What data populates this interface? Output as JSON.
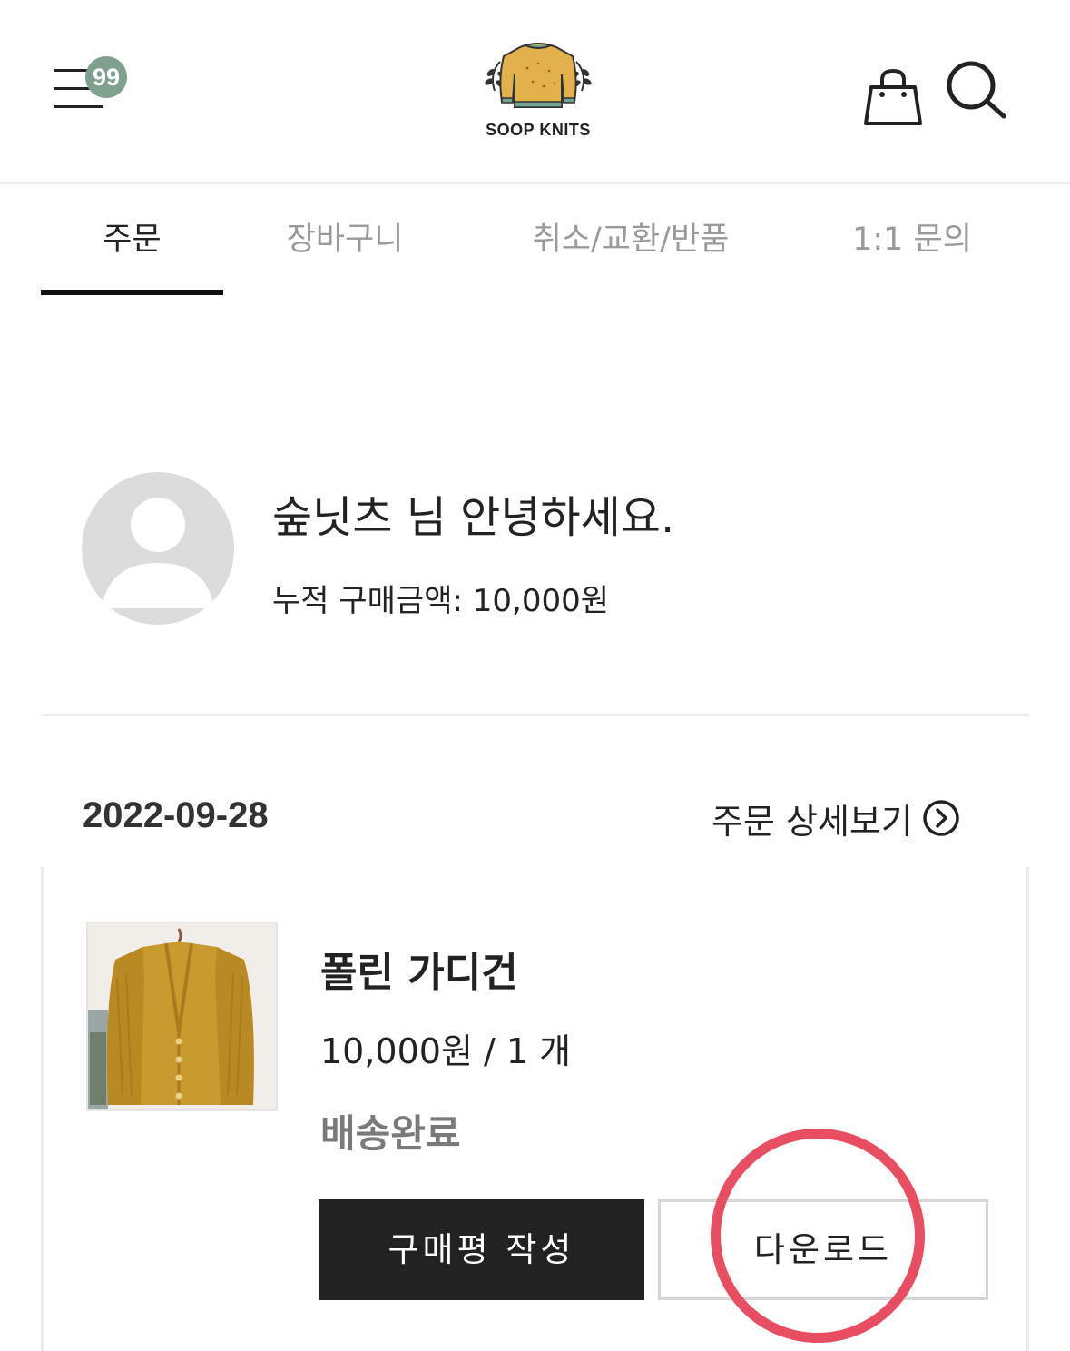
{
  "header": {
    "menu_badge": "99",
    "logo_text": "SOOP KNITS",
    "icons": {
      "menu": "hamburger-menu-icon",
      "cart": "shopping-bag-icon",
      "search": "search-icon"
    },
    "badge_color": "#7fa08e"
  },
  "tabs": [
    {
      "label": "주문",
      "active": true
    },
    {
      "label": "장바구니",
      "active": false
    },
    {
      "label": "취소/교환/반품",
      "active": false
    },
    {
      "label": "1:1 문의",
      "active": false
    }
  ],
  "profile": {
    "greeting": "숲닛츠 님 안녕하세요.",
    "total_purchase": "누적 구매금액: 10,000원"
  },
  "order": {
    "date": "2022-09-28",
    "detail_link": "주문 상세보기",
    "item": {
      "name": "폴린 가디건",
      "price_qty": "10,000원 / 1 개",
      "status": "배송완료"
    },
    "buttons": {
      "review": "구매평 작성",
      "download": "다운로드"
    }
  },
  "colors": {
    "highlight": "#e94d62",
    "primary_button": "#222222",
    "status_text": "#7a7a7a"
  }
}
